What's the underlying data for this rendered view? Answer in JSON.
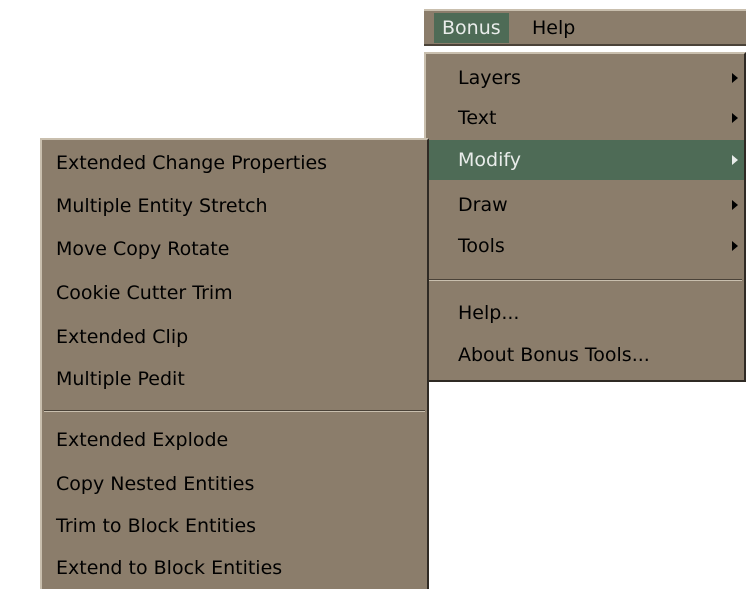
{
  "menubar": {
    "items": [
      {
        "label": "Bonus",
        "underline_char": "B"
      },
      {
        "label": "Help",
        "underline_char": "H"
      }
    ]
  },
  "bonus_menu": {
    "items": [
      {
        "label": "Layers",
        "has_submenu": true
      },
      {
        "label": "Text",
        "has_submenu": true
      },
      {
        "label": "Modify",
        "has_submenu": true,
        "highlighted": true
      },
      {
        "label": "Draw",
        "has_submenu": true
      },
      {
        "label": "Tools",
        "has_submenu": true
      },
      {
        "label": "Help...",
        "has_submenu": false
      },
      {
        "label": "About Bonus Tools...",
        "has_submenu": false
      }
    ]
  },
  "modify_submenu": {
    "items": [
      {
        "label": "Extended Change Properties"
      },
      {
        "label": "Multiple Entity Stretch"
      },
      {
        "label": "Move Copy Rotate"
      },
      {
        "label": "Cookie Cutter Trim"
      },
      {
        "label": "Extended Clip"
      },
      {
        "label": "Multiple Pedit"
      },
      {
        "label": "Extended Explode"
      },
      {
        "label": "Copy Nested Entities"
      },
      {
        "label": "Trim to Block Entities"
      },
      {
        "label": "Extend to Block Entities"
      }
    ]
  },
  "colors": {
    "menu_background": "#8b7d6b",
    "highlight_background": "#4e6b56",
    "highlight_text": "#e9ecea",
    "text": "#000000"
  }
}
